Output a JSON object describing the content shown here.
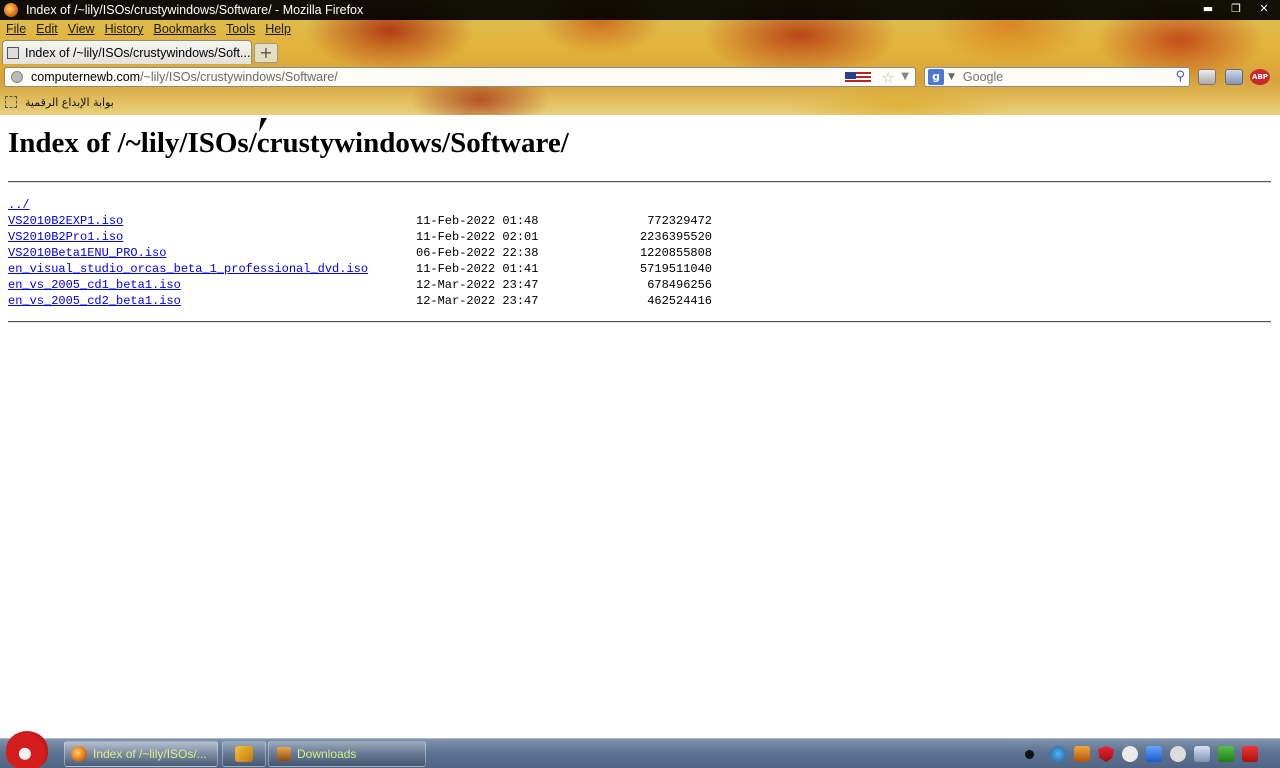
{
  "window": {
    "title": "Index of /~lily/ISOs/crustywindows/Software/ - Mozilla Firefox",
    "controls": {
      "minimize": "▬",
      "restore": "❐",
      "close": "✕"
    }
  },
  "menubar": {
    "items": [
      "File",
      "Edit",
      "View",
      "History",
      "Bookmarks",
      "Tools",
      "Help"
    ]
  },
  "tabs": {
    "active_title": "Index of /~lily/ISOs/crustywindows/Soft...",
    "new_tab_label": "+"
  },
  "navbar": {
    "url_host": "computernewb.com",
    "url_path": "/~lily/ISOs/crustywindows/Software/",
    "search_placeholder": "Google",
    "search_engine_letter": "g"
  },
  "bookmarks_bar": {
    "items": [
      "بوابة الإبداع الرقمية"
    ]
  },
  "page": {
    "heading": "Index of /~lily/ISOs/crustywindows/Software/",
    "parent_link": "../",
    "files": [
      {
        "name": "VS2010B2EXP1.iso",
        "date": "11-Feb-2022 01:48",
        "size": "772329472"
      },
      {
        "name": "VS2010B2Pro1.iso",
        "date": "11-Feb-2022 02:01",
        "size": "2236395520"
      },
      {
        "name": "VS2010Beta1ENU_PRO.iso",
        "date": "06-Feb-2022 22:38",
        "size": "1220855808"
      },
      {
        "name": "en_visual_studio_orcas_beta_1_professional_dvd.iso",
        "date": "11-Feb-2022 01:41",
        "size": "5719511040"
      },
      {
        "name": "en_vs_2005_cd1_beta1.iso",
        "date": "12-Mar-2022 23:47",
        "size": "678496256"
      },
      {
        "name": "en_vs_2005_cd2_beta1.iso",
        "date": "12-Mar-2022 23:47",
        "size": "462524416"
      }
    ]
  },
  "taskbar": {
    "items": [
      {
        "label": "Index of /~lily/ISOs/...",
        "icon": "firefox-icon"
      },
      {
        "label": "",
        "icon": "pinned-app-icon"
      },
      {
        "label": "Downloads",
        "icon": "downloads-icon"
      }
    ]
  },
  "colors": {
    "link": "#0000ee",
    "taskbar_text": "#d6f08a"
  }
}
